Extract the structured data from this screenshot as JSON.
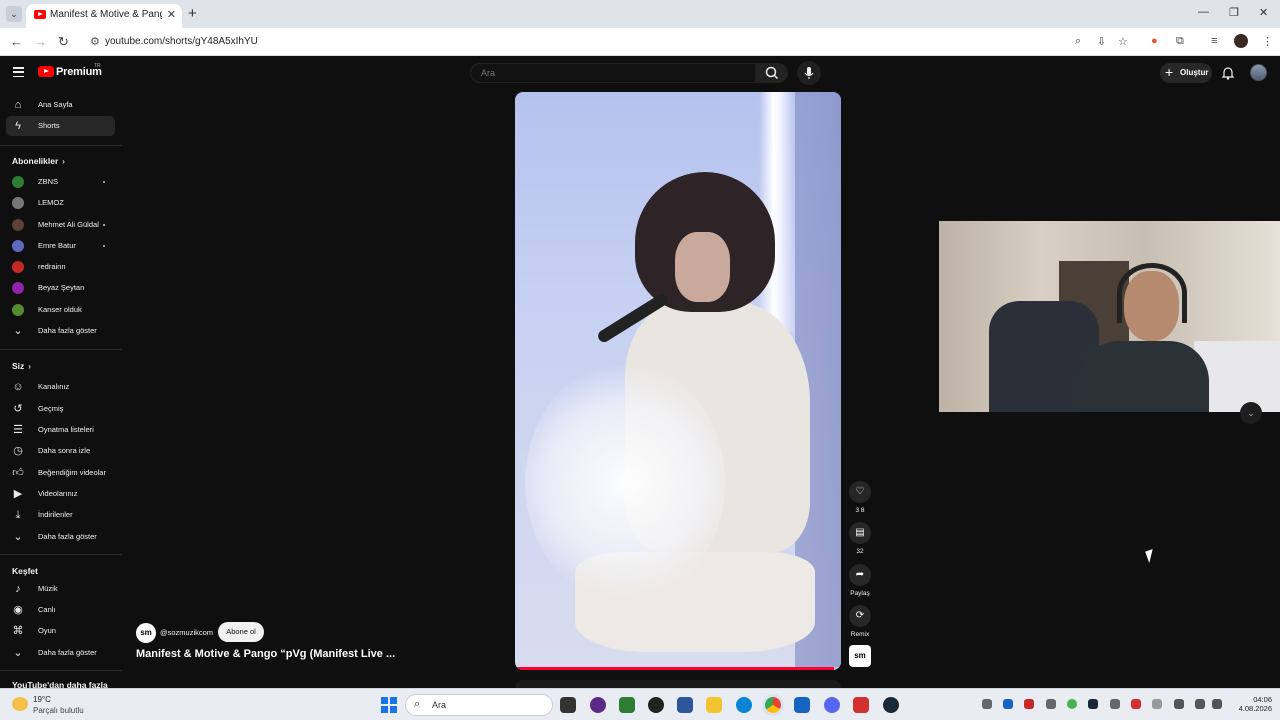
{
  "browser": {
    "tab_title": "Manifest & Motive & Pango “p",
    "url": "youtube.com/shorts/gY48A5xIhYU"
  },
  "header": {
    "logo_text": "Premium",
    "logo_region": "TR",
    "search_placeholder": "Ara",
    "create_label": "Oluştur"
  },
  "sidebar": {
    "main": [
      {
        "label": "Ana Sayfa",
        "icon": "home-icon"
      },
      {
        "label": "Shorts",
        "icon": "shorts-icon",
        "active": true
      }
    ],
    "subscriptions_title": "Abonelikler",
    "subscriptions": [
      {
        "label": "ZBNS",
        "dot": true,
        "color": "#2e7d32"
      },
      {
        "label": "LEMOZ",
        "dot": false,
        "color": "#777777"
      },
      {
        "label": "Mehmet Ali Güldal",
        "dot": true,
        "color": "#5d4037"
      },
      {
        "label": "Emre Batur",
        "dot": true,
        "color": "#5c6bc0"
      },
      {
        "label": "redrainn",
        "dot": false,
        "color": "#c62828"
      },
      {
        "label": "Beyaz Şeytan",
        "dot": false,
        "color": "#8e24aa"
      },
      {
        "label": "Kanser olduk",
        "dot": false,
        "color": "#558b2f"
      }
    ],
    "show_more": "Daha fazla göster",
    "you_title": "Siz",
    "you": [
      {
        "label": "Kanalınız",
        "icon": "channel-icon"
      },
      {
        "label": "Geçmiş",
        "icon": "history-icon"
      },
      {
        "label": "Oynatma listeleri",
        "icon": "playlist-icon"
      },
      {
        "label": "Daha sonra izle",
        "icon": "clock-icon"
      },
      {
        "label": "Beğendiğim videolar",
        "icon": "thumbs-up-icon"
      },
      {
        "label": "Videolarınız",
        "icon": "video-icon"
      },
      {
        "label": "İndirilenler",
        "icon": "download-icon"
      },
      {
        "label": "Daha fazla göster",
        "icon": "chevron-down-icon"
      }
    ],
    "explore_title": "Keşfet",
    "explore": [
      {
        "label": "Müzik",
        "icon": "music-icon"
      },
      {
        "label": "Canlı",
        "icon": "live-icon"
      },
      {
        "label": "Oyun",
        "icon": "gaming-icon"
      },
      {
        "label": "Daha fazla göster",
        "icon": "chevron-down-icon"
      }
    ],
    "more_from_youtube": "YouTube'dan daha fazla"
  },
  "short": {
    "channel_avatar": "sm",
    "channel_handle": "@sozmuzikcom",
    "subscribe_label": "Abone ol",
    "title": "Manifest & Motive & Pango “pVg (Manifest Live ...",
    "progress_fraction": 0.98,
    "like_count": "3 8",
    "comment_count": "32",
    "share_label": "Paylaş",
    "remix_label": "Remix",
    "sound_thumb": "sm"
  },
  "taskbar": {
    "temperature": "19°C",
    "condition": "Parçalı bulutlu",
    "search_label": "Ara",
    "time": "04:06",
    "date": "4.08.2026"
  }
}
